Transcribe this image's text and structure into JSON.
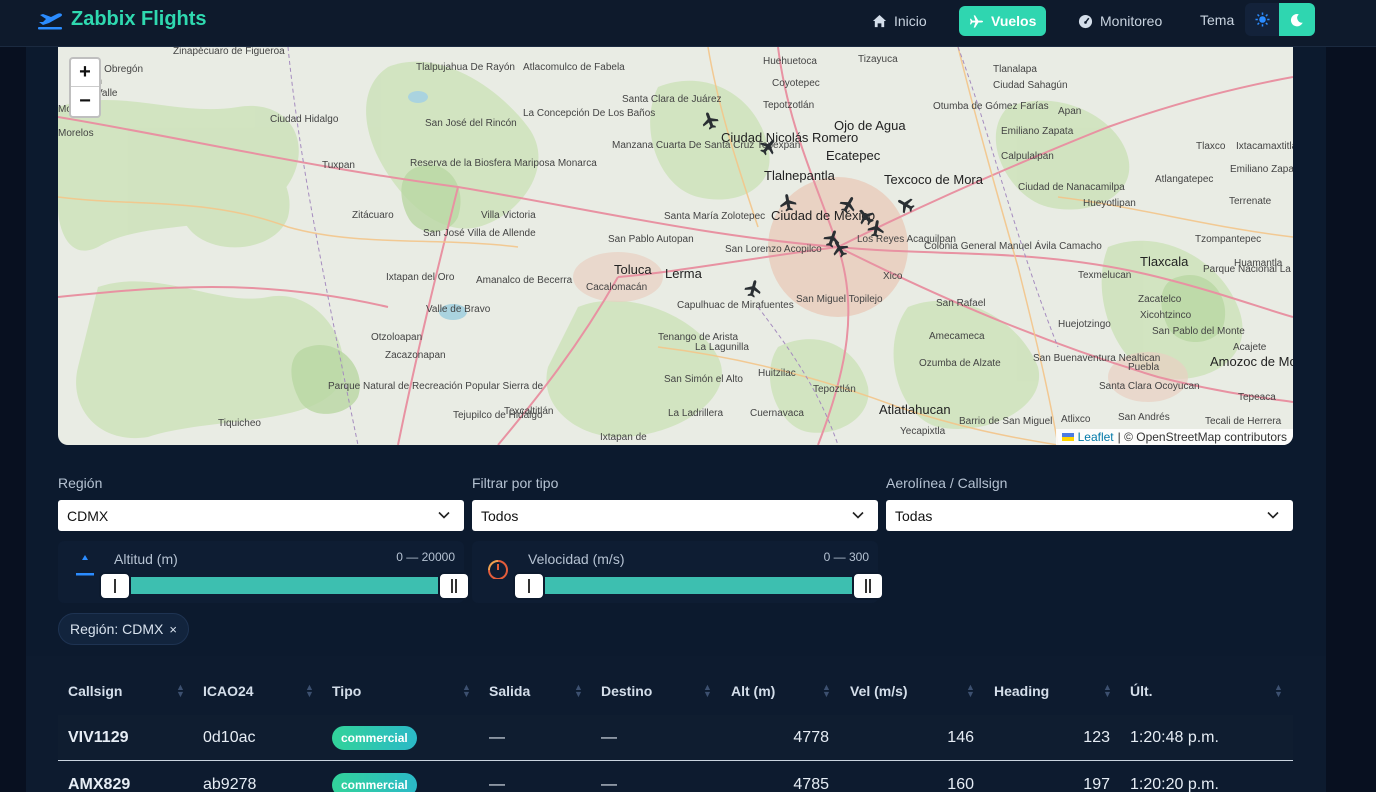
{
  "nav": {
    "brand": "Zabbix Flights",
    "items": [
      {
        "label": "Inicio",
        "icon": "home-icon"
      },
      {
        "label": "Vuelos",
        "icon": "plane-icon",
        "active": true
      },
      {
        "label": "Monitoreo",
        "icon": "gauge-icon"
      }
    ],
    "theme_label": "Tema",
    "accent": "#2fd6b0"
  },
  "map": {
    "zoom_in": "+",
    "zoom_out": "−",
    "attribution_leaflet": "Leaflet",
    "attribution_rest": "| © OpenStreetMap contributors",
    "labels": [
      "Álvaro Obregón",
      "Misión",
      "Valle",
      "Morelia",
      "Morelos",
      "Zinapécuaro de Figueroa",
      "Ciudad Hidalgo",
      "Tlalpujahua De Rayón",
      "Atlacomulco de Fabela",
      "San José del Rincón",
      "La Concepción De Los Baños",
      "Santa Clara de Juárez",
      "Huehuetoca",
      "Tizayuca",
      "Tlanalapa",
      "Ciudad Sahagún",
      "Coyotepec",
      "Tepotzotlán",
      "Otumba de Gómez Farías",
      "Apan",
      "Emiliano Zapata",
      "Ciudad Nicolás Romero",
      "Ojo de Agua",
      "Ecatepec",
      "Calpulalpan",
      "Tlaxco",
      "Ixtacamaxtitlán",
      "Emiliano Zapata",
      "Tuxpan",
      "Reserva de la Biosfera Mariposa Monarca",
      "Manzana Cuarta De Santa Cruz Tepexpan",
      "Tlalnepantla",
      "Texcoco de Mora",
      "Ciudad de Nanacamilpa",
      "Hueyotlipan",
      "Atlangatepec",
      "Terrenate",
      "Zitácuaro",
      "Villa Victoria",
      "San José Villa de Allende",
      "Santa María Zolotepec",
      "San Pablo Autopan",
      "Ciudad de México",
      "Los Reyes Acaquilpan",
      "Colonia General Manuel Ávila Camacho",
      "Tlaxcala",
      "Tzompantepec",
      "Huamantla",
      "Toluca",
      "Lerma",
      "San Lorenzo Acopilco",
      "Ixtapan del Oro",
      "Amanalco de Becerra",
      "Valle de Bravo",
      "Cacalomacán",
      "Capulhuac de Mirafuentes",
      "Xico",
      "San Miguel Topilejo",
      "Texmelucan",
      "San Rafael",
      "Zacatelco",
      "Xicohtzinco",
      "Parque Nacional La Montaña Malinche",
      "Otzoloapan",
      "Zacazonapan",
      "Tenango de Arista",
      "La Lagunilla",
      "Amecameca",
      "Huejotzingo",
      "San Pablo del Monte",
      "Acajete",
      "Ozumba de Alzate",
      "San Buenaventura Nealtican",
      "Puebla",
      "Amozoc de Mota",
      "Parque Natural de Recreación Popular Sierra de",
      "San Simón el Alto",
      "Huitzilac",
      "Tepoztlán",
      "Santa Clara Ocoyucan",
      "Tepeaca",
      "Tiquicheo",
      "Tejupilco de Hidalgo",
      "Texcaltitlán",
      "La Ladrillera",
      "Cuernavaca",
      "Atlatlahucan",
      "Yecapixtla",
      "Barrio de San Miguel",
      "Atlixco",
      "San Andrés",
      "Tecali de Herrera",
      "Ixtapan de"
    ]
  },
  "filters": {
    "region": {
      "label": "Región",
      "value": "CDMX"
    },
    "type": {
      "label": "Filtrar por tipo",
      "value": "Todos"
    },
    "airline": {
      "label": "Aerolínea / Callsign",
      "value": "Todas"
    },
    "altitude": {
      "label": "Altitud (m)",
      "range_text": "0 — 20000",
      "min": 0,
      "max": 20000
    },
    "speed": {
      "label": "Velocidad (m/s)",
      "range_text": "0 — 300",
      "min": 0,
      "max": 300
    },
    "active_chip": "Región: CDMX",
    "chip_remove": "×"
  },
  "table": {
    "headers": [
      "Callsign",
      "ICAO24",
      "Tipo",
      "Salida",
      "Destino",
      "Alt (m)",
      "Vel (m/s)",
      "Heading",
      "Últ."
    ],
    "rows": [
      {
        "callsign": "VIV1129",
        "icao24": "0d10ac",
        "tipo": "commercial",
        "salida": "—",
        "destino": "—",
        "alt": "4778",
        "vel": "146",
        "heading": "123",
        "ult": "1:20:48 p.m."
      },
      {
        "callsign": "AMX829",
        "icao24": "ab9278",
        "tipo": "commercial",
        "salida": "—",
        "destino": "—",
        "alt": "4785",
        "vel": "160",
        "heading": "197",
        "ult": "1:20:20 p.m."
      }
    ]
  }
}
